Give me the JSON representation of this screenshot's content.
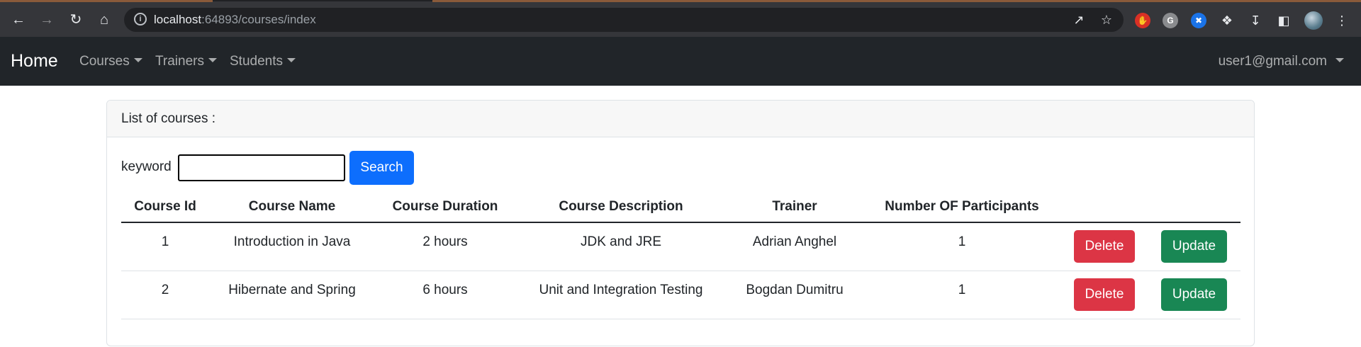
{
  "browser": {
    "url_host": "localhost",
    "url_rest": ":64893/courses/index"
  },
  "navbar": {
    "brand": "Home",
    "menus": [
      {
        "label": "Courses"
      },
      {
        "label": "Trainers"
      },
      {
        "label": "Students"
      }
    ],
    "user": "user1@gmail.com"
  },
  "card": {
    "header": "List of courses :",
    "search": {
      "label": "keyword",
      "value": "",
      "button": "Search"
    },
    "table": {
      "columns": [
        "Course Id",
        "Course Name",
        "Course Duration",
        "Course Description",
        "Trainer",
        "Number OF Participants",
        "",
        ""
      ],
      "rows": [
        {
          "id": "1",
          "name": "Introduction in Java",
          "duration": "2 hours",
          "description": "JDK and JRE",
          "trainer": "Adrian Anghel",
          "participants": "1",
          "delete": "Delete",
          "update": "Update"
        },
        {
          "id": "2",
          "name": "Hibernate and Spring",
          "duration": "6 hours",
          "description": "Unit and Integration Testing",
          "trainer": "Bogdan Dumitru",
          "participants": "1",
          "delete": "Delete",
          "update": "Update"
        }
      ]
    }
  },
  "colors": {
    "primary": "#0d6efd",
    "danger": "#dc3545",
    "success": "#198754",
    "navbar": "#212529"
  }
}
